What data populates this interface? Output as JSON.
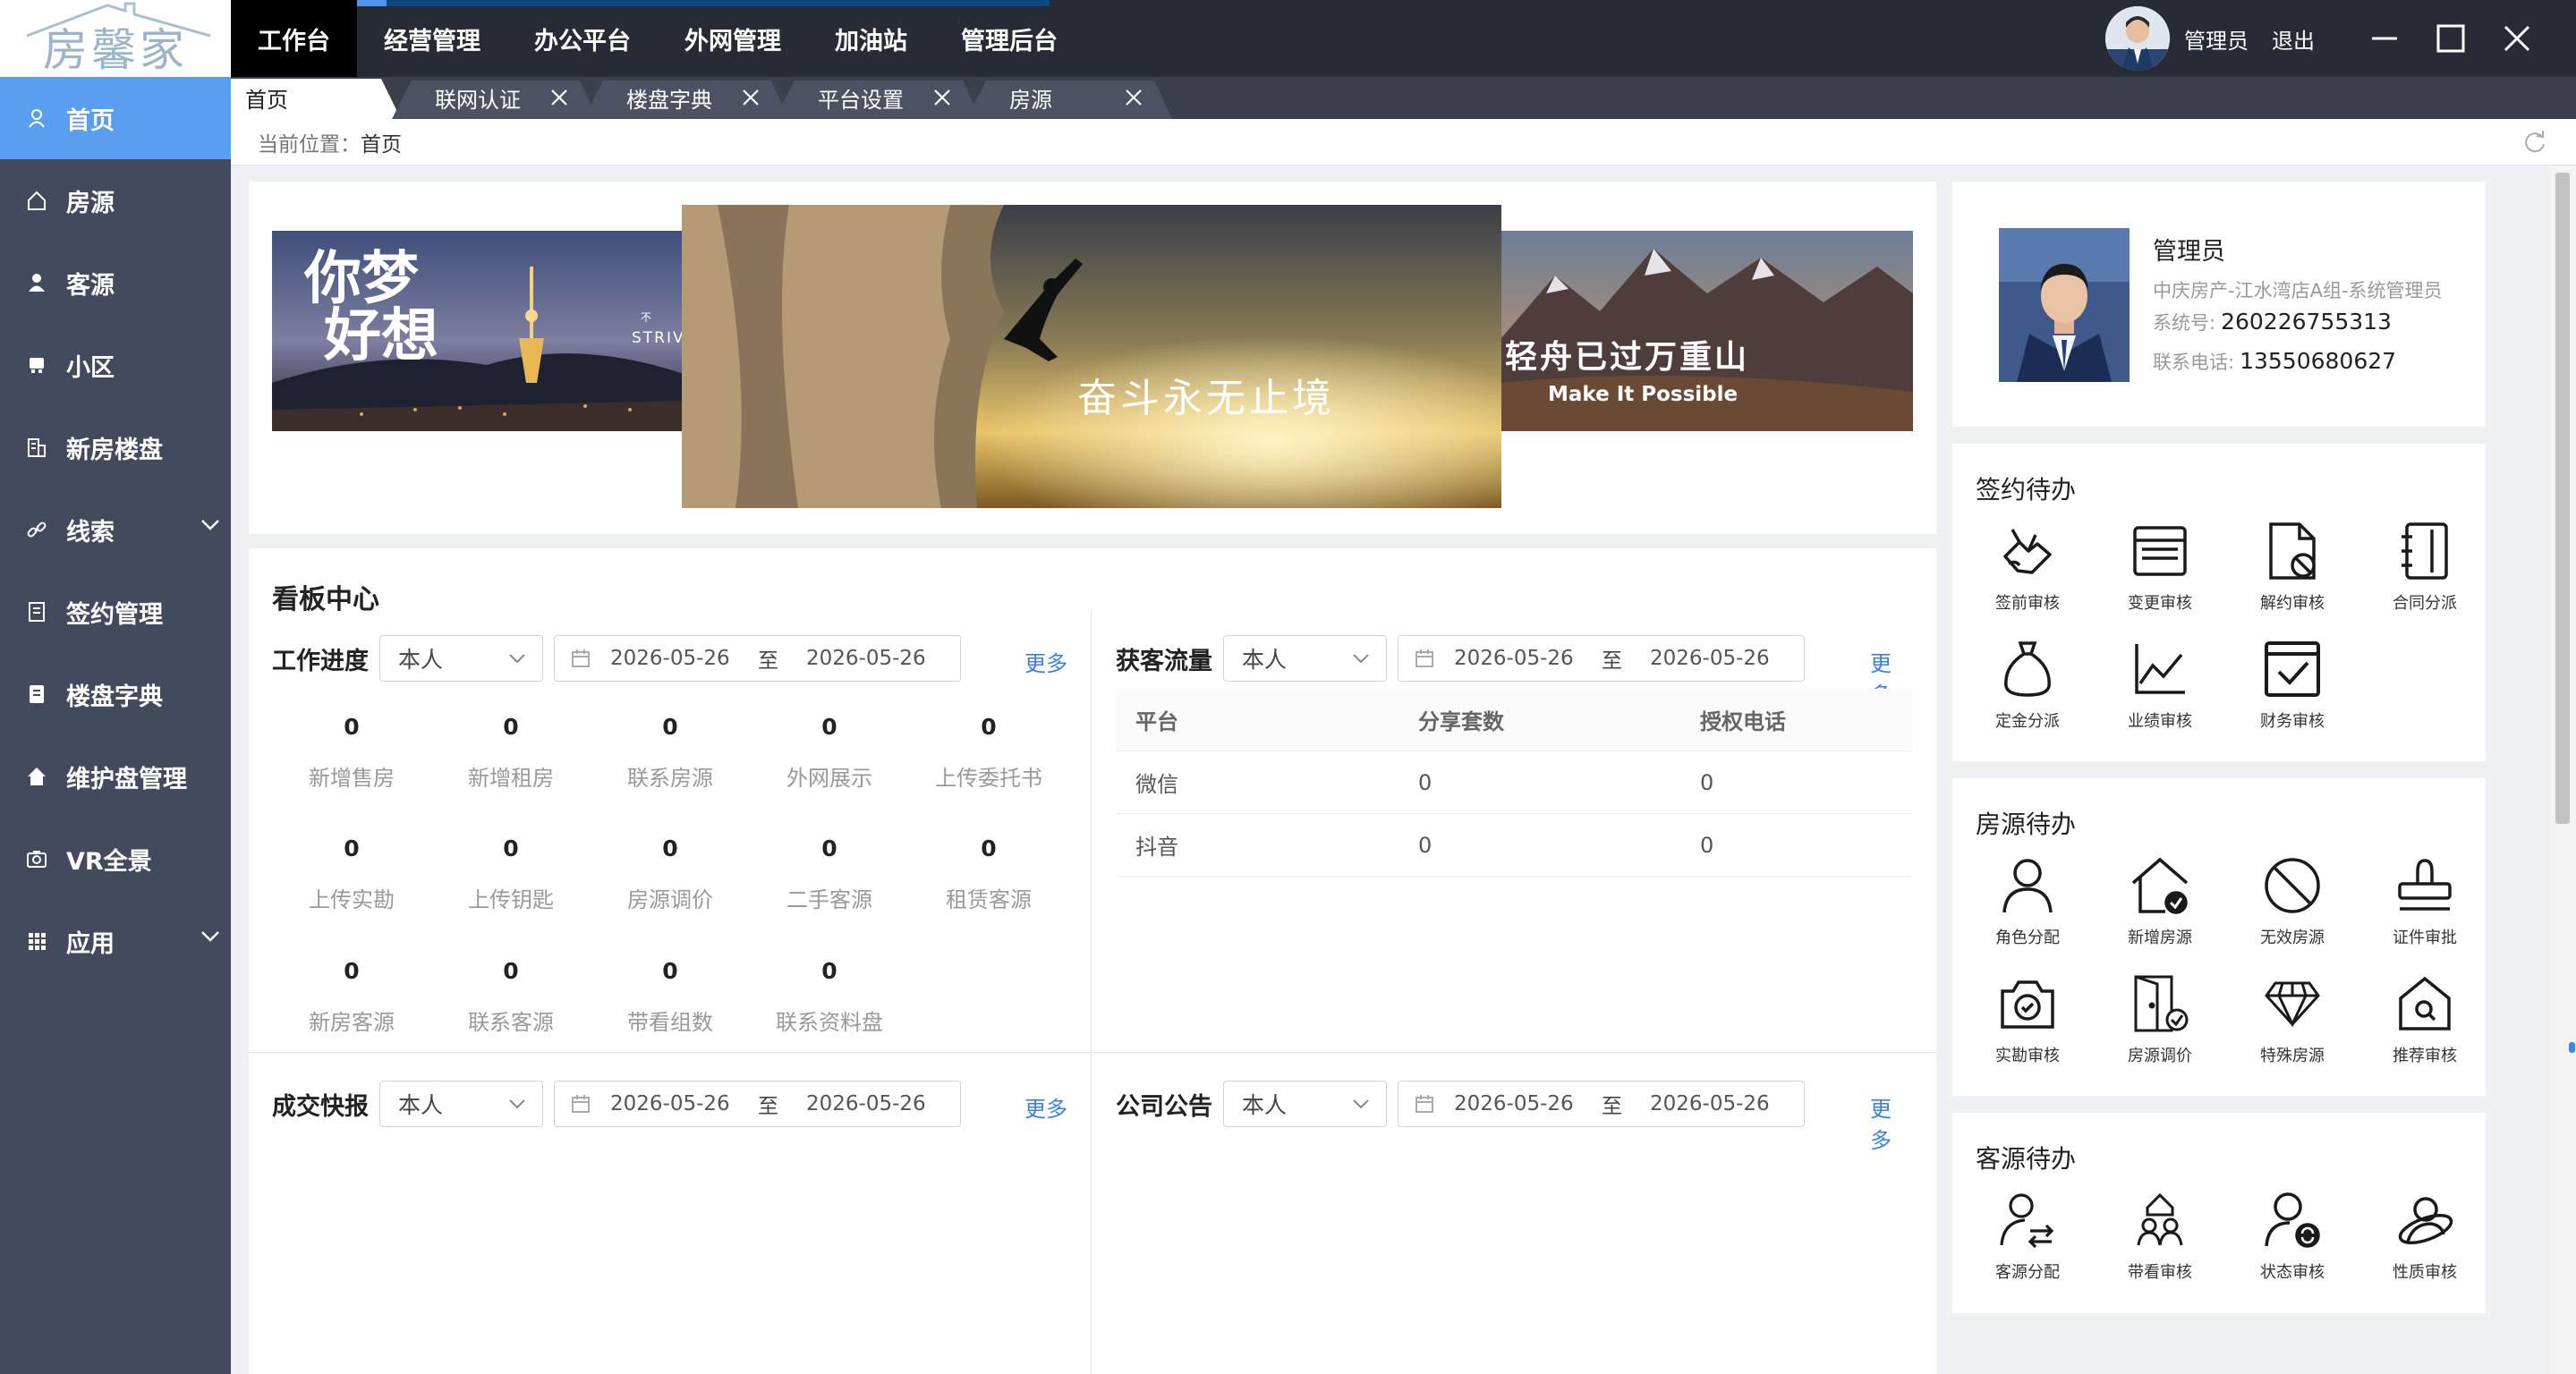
{
  "app": {
    "logo_text": "房馨家"
  },
  "topnav": {
    "items": [
      "工作台",
      "经营管理",
      "办公平台",
      "外网管理",
      "加油站",
      "管理后台"
    ],
    "active_index": 0,
    "loading_progress": 0.19
  },
  "user": {
    "name": "管理员",
    "logout": "退出"
  },
  "window_controls": [
    "minimize-icon",
    "maximize-icon",
    "close-icon"
  ],
  "sidebar": {
    "items": [
      {
        "label": "首页",
        "icon": "user-icon",
        "active": true
      },
      {
        "label": "房源",
        "icon": "house-icon"
      },
      {
        "label": "客源",
        "icon": "person-icon"
      },
      {
        "label": "小区",
        "icon": "community-icon"
      },
      {
        "label": "新房楼盘",
        "icon": "building-icon"
      },
      {
        "label": "线索",
        "icon": "link-icon",
        "expandable": true
      },
      {
        "label": "签约管理",
        "icon": "document-icon"
      },
      {
        "label": "楼盘字典",
        "icon": "dictionary-icon"
      },
      {
        "label": "维护盘管理",
        "icon": "home-icon"
      },
      {
        "label": "VR全景",
        "icon": "camera-icon"
      },
      {
        "label": "应用",
        "icon": "grid-icon",
        "expandable": true
      }
    ]
  },
  "tabs": [
    {
      "label": "首页",
      "active": true,
      "closable": false
    },
    {
      "label": "联网认证",
      "closable": true
    },
    {
      "label": "楼盘字典",
      "closable": true
    },
    {
      "label": "平台设置",
      "closable": true
    },
    {
      "label": "房源",
      "closable": true
    }
  ],
  "breadcrumb": {
    "prefix": "当前位置：",
    "current": "首页"
  },
  "banners": {
    "left": {
      "title_chars": [
        "你",
        "梦",
        "好",
        "想"
      ],
      "overlay_text": "STRIV",
      "overlay_small": "不"
    },
    "center": {
      "text": "奋斗永无止境"
    },
    "right": {
      "text": "轻舟已过万重山",
      "subtext": "Make It Possible"
    }
  },
  "dashboard": {
    "title": "看板中心",
    "work_progress": {
      "label": "工作进度",
      "select": "本人",
      "date_from": "2026-05-26",
      "to": "至",
      "date_to": "2026-05-26",
      "more": "更多",
      "stats": [
        {
          "value": "0",
          "label": "新增售房"
        },
        {
          "value": "0",
          "label": "新增租房"
        },
        {
          "value": "0",
          "label": "联系房源"
        },
        {
          "value": "0",
          "label": "外网展示"
        },
        {
          "value": "0",
          "label": "上传委托书"
        },
        {
          "value": "0",
          "label": "上传实勘"
        },
        {
          "value": "0",
          "label": "上传钥匙"
        },
        {
          "value": "0",
          "label": "房源调价"
        },
        {
          "value": "0",
          "label": "二手客源"
        },
        {
          "value": "0",
          "label": "租赁客源"
        },
        {
          "value": "0",
          "label": "新房客源"
        },
        {
          "value": "0",
          "label": "联系客源"
        },
        {
          "value": "0",
          "label": "带看组数"
        },
        {
          "value": "0",
          "label": "联系资料盘"
        }
      ]
    },
    "traffic": {
      "label": "获客流量",
      "select": "本人",
      "date_from": "2026-05-26",
      "to": "至",
      "date_to": "2026-05-26",
      "more": "更多",
      "columns": [
        "平台",
        "分享套数",
        "授权电话"
      ],
      "rows": [
        [
          "微信",
          "0",
          "0"
        ],
        [
          "抖音",
          "0",
          "0"
        ]
      ]
    },
    "deals": {
      "label": "成交快报",
      "select": "本人",
      "date_from": "2026-05-26",
      "to": "至",
      "date_to": "2026-05-26",
      "more": "更多"
    },
    "notices": {
      "label": "公司公告",
      "select": "本人",
      "date_from": "2026-05-26",
      "to": "至",
      "date_to": "2026-05-26",
      "more": "更多"
    }
  },
  "profile": {
    "name": "管理员",
    "org": "中庆房产-江水湾店A组-系统管理员",
    "id_label": "系统号:",
    "id_value": "260226755313",
    "phone_label": "联系电话:",
    "phone_value": "13550680627"
  },
  "todo_sign": {
    "title": "签约待办",
    "items": [
      {
        "label": "签前审核",
        "icon": "hand-sign-icon"
      },
      {
        "label": "变更审核",
        "icon": "browser-window-icon"
      },
      {
        "label": "解约审核",
        "icon": "doc-ban-icon"
      },
      {
        "label": "合同分派",
        "icon": "notebook-icon"
      },
      {
        "label": "定金分派",
        "icon": "money-bag-icon"
      },
      {
        "label": "业绩审核",
        "icon": "line-chart-icon"
      },
      {
        "label": "财务审核",
        "icon": "checkbox-icon"
      }
    ]
  },
  "todo_house": {
    "title": "房源待办",
    "items": [
      {
        "label": "角色分配",
        "icon": "person-icon"
      },
      {
        "label": "新增房源",
        "icon": "house-check-icon"
      },
      {
        "label": "无效房源",
        "icon": "ban-icon"
      },
      {
        "label": "证件审批",
        "icon": "stamp-icon"
      },
      {
        "label": "实勘审核",
        "icon": "camera-check-icon"
      },
      {
        "label": "房源调价",
        "icon": "door-check-icon"
      },
      {
        "label": "特殊房源",
        "icon": "diamond-icon"
      },
      {
        "label": "推荐审核",
        "icon": "house-search-icon"
      }
    ]
  },
  "todo_client": {
    "title": "客源待办",
    "items": [
      {
        "label": "客源分配",
        "icon": "person-switch-icon"
      },
      {
        "label": "带看审核",
        "icon": "people-house-icon"
      },
      {
        "label": "状态审核",
        "icon": "person-refresh-icon"
      },
      {
        "label": "性质审核",
        "icon": "person-orbit-icon"
      }
    ]
  }
}
